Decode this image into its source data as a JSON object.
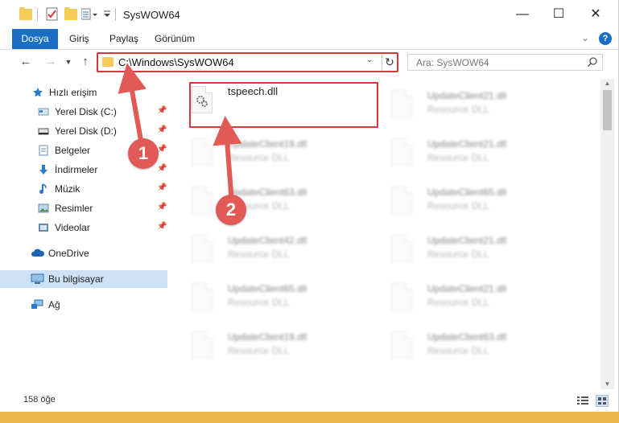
{
  "window": {
    "title": "SysWOW64"
  },
  "ribbon": {
    "tabs": [
      "Dosya",
      "Giriş",
      "Paylaş",
      "Görünüm"
    ],
    "help_label": "?"
  },
  "address_bar": {
    "path": "C:\\Windows\\SysWOW64",
    "search_placeholder": "Ara: SysWOW64"
  },
  "nav_pane": {
    "items": [
      {
        "label": "Hızlı erişim",
        "icon": "star-icon"
      },
      {
        "label": "Yerel Disk (C:)",
        "icon": "drive-icon"
      },
      {
        "label": "Yerel Disk (D:)",
        "icon": "drive-icon"
      },
      {
        "label": "Belgeler",
        "icon": "documents-icon"
      },
      {
        "label": "İndirmeler",
        "icon": "download-icon"
      },
      {
        "label": "Müzik",
        "icon": "music-icon"
      },
      {
        "label": "Resimler",
        "icon": "pictures-icon"
      },
      {
        "label": "Videolar",
        "icon": "videos-icon"
      },
      {
        "label": "OneDrive",
        "icon": "cloud-icon"
      },
      {
        "label": "Bu bilgisayar",
        "icon": "computer-icon"
      },
      {
        "label": "Ağ",
        "icon": "network-icon"
      }
    ]
  },
  "files": [
    {
      "name": "tspeech.dll",
      "type": ""
    },
    {
      "name": "UpdateClient21.dll",
      "type": "Resource DLL"
    },
    {
      "name": "UpdateClient19.dll",
      "type": "Resource DLL"
    },
    {
      "name": "UpdateClient21.dll",
      "type": "Resource DLL"
    },
    {
      "name": "UpdateClient63.dll",
      "type": "Resource DLL"
    },
    {
      "name": "UpdateClient65.dll",
      "type": "Resource DLL"
    },
    {
      "name": "UpdateClient42.dll",
      "type": "Resource DLL"
    },
    {
      "name": "UpdateClient21.dll",
      "type": "Resource DLL"
    },
    {
      "name": "UpdateClient65.dll",
      "type": "Resource DLL"
    },
    {
      "name": "UpdateClient21.dll",
      "type": "Resource DLL"
    },
    {
      "name": "UpdateClient19.dll",
      "type": "Resource DLL"
    },
    {
      "name": "UpdateClient63.dll",
      "type": "Resource DLL"
    }
  ],
  "status": {
    "count": "158 öğe"
  },
  "callouts": {
    "one": "1",
    "two": "2"
  },
  "colors": {
    "accent": "#1a6fc4",
    "highlight": "#d9373f",
    "callout": "#e25a56",
    "selected": "#cde2f7"
  }
}
